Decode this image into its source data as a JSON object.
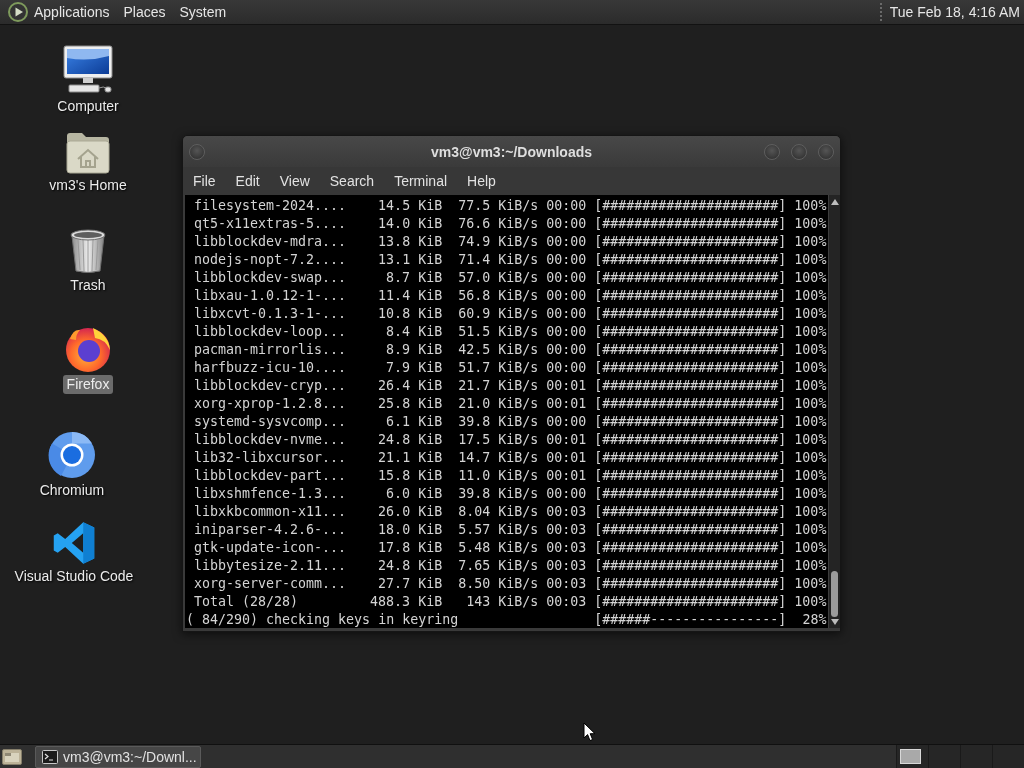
{
  "top_panel": {
    "menus": [
      "Applications",
      "Places",
      "System"
    ],
    "clock": "Tue Feb 18, 4:16 AM"
  },
  "desktop": {
    "icons": [
      {
        "kind": "computer",
        "label": "Computer",
        "selected": false
      },
      {
        "kind": "home",
        "label": "vm3's Home",
        "selected": false
      },
      {
        "kind": "trash",
        "label": "Trash",
        "selected": false
      },
      {
        "kind": "firefox",
        "label": "Firefox",
        "selected": true
      },
      {
        "kind": "chromium",
        "label": "Chromium",
        "selected": false
      },
      {
        "kind": "vscode",
        "label": "Visual Studio Code",
        "selected": false
      }
    ]
  },
  "terminal": {
    "title": "vm3@vm3:~/Downloads",
    "menu": [
      "File",
      "Edit",
      "View",
      "Search",
      "Terminal",
      "Help"
    ],
    "rows": [
      {
        "name": "filesystem-2024....",
        "size": "14.5 KiB",
        "rate": "77.5 KiB/s",
        "time": "00:00",
        "bar": "[######################]",
        "percent": "100%"
      },
      {
        "name": "qt5-x11extras-5....",
        "size": "14.0 KiB",
        "rate": "76.6 KiB/s",
        "time": "00:00",
        "bar": "[######################]",
        "percent": "100%"
      },
      {
        "name": "libblockdev-mdra...",
        "size": "13.8 KiB",
        "rate": "74.9 KiB/s",
        "time": "00:00",
        "bar": "[######################]",
        "percent": "100%"
      },
      {
        "name": "nodejs-nopt-7.2....",
        "size": "13.1 KiB",
        "rate": "71.4 KiB/s",
        "time": "00:00",
        "bar": "[######################]",
        "percent": "100%"
      },
      {
        "name": "libblockdev-swap...",
        "size": "8.7 KiB",
        "rate": "57.0 KiB/s",
        "time": "00:00",
        "bar": "[######################]",
        "percent": "100%"
      },
      {
        "name": "libxau-1.0.12-1-...",
        "size": "11.4 KiB",
        "rate": "56.8 KiB/s",
        "time": "00:00",
        "bar": "[######################]",
        "percent": "100%"
      },
      {
        "name": "libxcvt-0.1.3-1-...",
        "size": "10.8 KiB",
        "rate": "60.9 KiB/s",
        "time": "00:00",
        "bar": "[######################]",
        "percent": "100%"
      },
      {
        "name": "libblockdev-loop...",
        "size": "8.4 KiB",
        "rate": "51.5 KiB/s",
        "time": "00:00",
        "bar": "[######################]",
        "percent": "100%"
      },
      {
        "name": "pacman-mirrorlis...",
        "size": "8.9 KiB",
        "rate": "42.5 KiB/s",
        "time": "00:00",
        "bar": "[######################]",
        "percent": "100%"
      },
      {
        "name": "harfbuzz-icu-10....",
        "size": "7.9 KiB",
        "rate": "51.7 KiB/s",
        "time": "00:00",
        "bar": "[######################]",
        "percent": "100%"
      },
      {
        "name": "libblockdev-cryp...",
        "size": "26.4 KiB",
        "rate": "21.7 KiB/s",
        "time": "00:01",
        "bar": "[######################]",
        "percent": "100%"
      },
      {
        "name": "xorg-xprop-1.2.8...",
        "size": "25.8 KiB",
        "rate": "21.0 KiB/s",
        "time": "00:01",
        "bar": "[######################]",
        "percent": "100%"
      },
      {
        "name": "systemd-sysvcomp...",
        "size": "6.1 KiB",
        "rate": "39.8 KiB/s",
        "time": "00:00",
        "bar": "[######################]",
        "percent": "100%"
      },
      {
        "name": "libblockdev-nvme...",
        "size": "24.8 KiB",
        "rate": "17.5 KiB/s",
        "time": "00:01",
        "bar": "[######################]",
        "percent": "100%"
      },
      {
        "name": "lib32-libxcursor...",
        "size": "21.1 KiB",
        "rate": "14.7 KiB/s",
        "time": "00:01",
        "bar": "[######################]",
        "percent": "100%"
      },
      {
        "name": "libblockdev-part...",
        "size": "15.8 KiB",
        "rate": "11.0 KiB/s",
        "time": "00:01",
        "bar": "[######################]",
        "percent": "100%"
      },
      {
        "name": "libxshmfence-1.3...",
        "size": "6.0 KiB",
        "rate": "39.8 KiB/s",
        "time": "00:00",
        "bar": "[######################]",
        "percent": "100%"
      },
      {
        "name": "libxkbcommon-x11...",
        "size": "26.0 KiB",
        "rate": "8.04 KiB/s",
        "time": "00:03",
        "bar": "[######################]",
        "percent": "100%"
      },
      {
        "name": "iniparser-4.2.6-...",
        "size": "18.0 KiB",
        "rate": "5.57 KiB/s",
        "time": "00:03",
        "bar": "[######################]",
        "percent": "100%"
      },
      {
        "name": "gtk-update-icon-...",
        "size": "17.8 KiB",
        "rate": "5.48 KiB/s",
        "time": "00:03",
        "bar": "[######################]",
        "percent": "100%"
      },
      {
        "name": "libbytesize-2.11...",
        "size": "24.8 KiB",
        "rate": "7.65 KiB/s",
        "time": "00:03",
        "bar": "[######################]",
        "percent": "100%"
      },
      {
        "name": "xorg-server-comm...",
        "size": "27.7 KiB",
        "rate": "8.50 KiB/s",
        "time": "00:03",
        "bar": "[######################]",
        "percent": "100%"
      },
      {
        "name": "Total (28/28)",
        "size": "488.3 KiB",
        "rate": "143 KiB/s",
        "time": "00:03",
        "bar": "[######################]",
        "percent": "100%"
      }
    ],
    "status": {
      "message": "( 84/290) checking keys in keyring",
      "bar": "[######----------------]",
      "percent": "28%"
    }
  },
  "bottom_panel": {
    "tasks": [
      {
        "label": "vm3@vm3:~/Downl..."
      }
    ],
    "workspaces": [
      {
        "has_window": true
      },
      {
        "has_window": false
      },
      {
        "has_window": false
      },
      {
        "has_window": false
      }
    ]
  }
}
